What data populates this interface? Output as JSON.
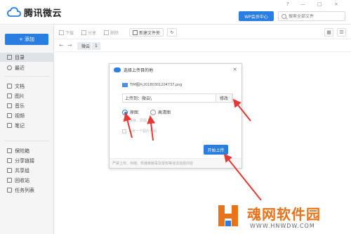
{
  "app": {
    "name": "腾讯微云",
    "vip_label": "WP会员中心"
  },
  "search": {
    "placeholder": "搜索全部文件"
  },
  "window_controls": [
    "?",
    "—",
    "□",
    "×"
  ],
  "sidebar": {
    "add_label": "+ 添加",
    "items": [
      {
        "label": "目录",
        "active": true,
        "icon": "folder-icon"
      },
      {
        "label": "最近",
        "active": false,
        "icon": "clock-icon"
      },
      {
        "label": "文档",
        "active": false,
        "icon": "document-icon"
      },
      {
        "label": "图片",
        "active": false,
        "icon": "image-icon"
      },
      {
        "label": "音乐",
        "active": false,
        "icon": "music-icon"
      },
      {
        "label": "视频",
        "active": false,
        "icon": "video-icon"
      },
      {
        "label": "笔记",
        "active": false,
        "icon": "note-icon"
      },
      {
        "label": "保险箱",
        "active": false,
        "icon": "safe-icon"
      },
      {
        "label": "分享链接",
        "active": false,
        "icon": "share-icon"
      },
      {
        "label": "共享组",
        "active": false,
        "icon": "group-icon"
      },
      {
        "label": "回收站",
        "active": false,
        "icon": "trash-icon"
      },
      {
        "label": "任务列表",
        "active": false,
        "icon": "task-icon"
      }
    ]
  },
  "toolbar": {
    "download": "下载",
    "share": "分享",
    "delete": "删除",
    "new_folder": "新建文件夹"
  },
  "breadcrumb": {
    "current": "微云",
    "tab": "1"
  },
  "modal": {
    "title": "选择上传目的地",
    "file_name": "TIM图片20180301204737.png",
    "upload_to": "上传到：微云\\",
    "change_label": "修改",
    "option_original": "原图",
    "option_hd": "高清图",
    "hint": "无损保存，原图上传",
    "checkbox_label": "每张一个图片分组",
    "start_label": "开始上传",
    "footer": "严禁上传、存储、传播黄赌毒及侵权等违法违规内容"
  },
  "watermark": {
    "brand": "魂网软件园",
    "url": "WWW.HNWDW.COM"
  },
  "colors": {
    "accent": "#2a7de1",
    "arrow": "#e53935",
    "watermark_orange": "#e8731a"
  }
}
